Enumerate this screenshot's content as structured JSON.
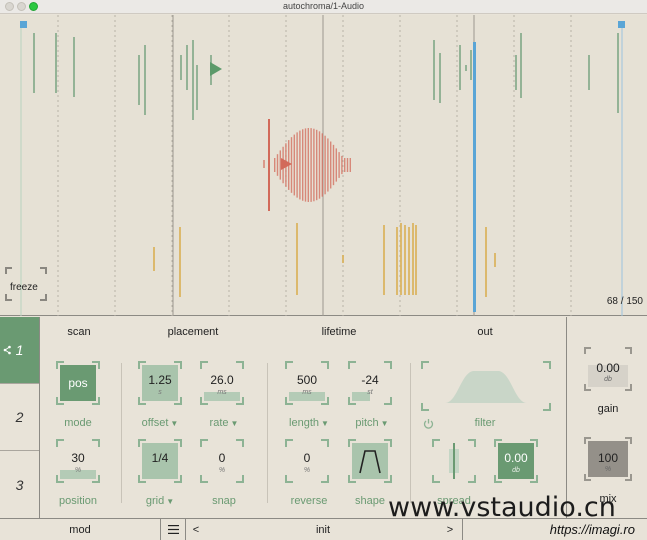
{
  "window": {
    "title": "autochroma/1-Audio"
  },
  "visualizer": {
    "freeze_label": "freeze",
    "counter_current": "68",
    "counter_sep": "/",
    "counter_total": "150",
    "colors": {
      "green": "#7fa886",
      "red": "#d26a5a",
      "yellow": "#d9b25a",
      "blue": "#5aa5d6"
    }
  },
  "tabs": [
    "1",
    "2",
    "3"
  ],
  "sections": {
    "scan": "scan",
    "placement": "placement",
    "lifetime": "lifetime",
    "out": "out"
  },
  "controls": {
    "mode": {
      "value": "pos",
      "label": "mode"
    },
    "position": {
      "value": "30",
      "unit": "%",
      "label": "position"
    },
    "offset": {
      "value": "1.25",
      "unit": "s",
      "label": "offset"
    },
    "rate": {
      "value": "26.0",
      "unit": "ms",
      "label": "rate"
    },
    "grid": {
      "value": "1/4",
      "label": "grid"
    },
    "snap": {
      "value": "0",
      "unit": "%",
      "label": "snap"
    },
    "length": {
      "value": "500",
      "unit": "ms",
      "label": "length"
    },
    "pitch": {
      "value": "-24",
      "unit": "st",
      "label": "pitch"
    },
    "reverse": {
      "value": "0",
      "unit": "%",
      "label": "reverse"
    },
    "shape": {
      "label": "shape"
    },
    "filter": {
      "label": "filter"
    },
    "spread": {
      "label": "spread"
    },
    "out_db": {
      "value": "0.00",
      "unit": "db"
    }
  },
  "gain": {
    "value": "0.00",
    "unit": "db",
    "label": "gain"
  },
  "mix": {
    "value": "100",
    "unit": "%",
    "label": "mix"
  },
  "footer": {
    "mod": "mod",
    "menu_icon": "hamburger-icon",
    "prev": "<",
    "preset": "init",
    "next": ">",
    "site": "https://imagi.ro"
  },
  "watermark": "www.vstaudio.cn"
}
